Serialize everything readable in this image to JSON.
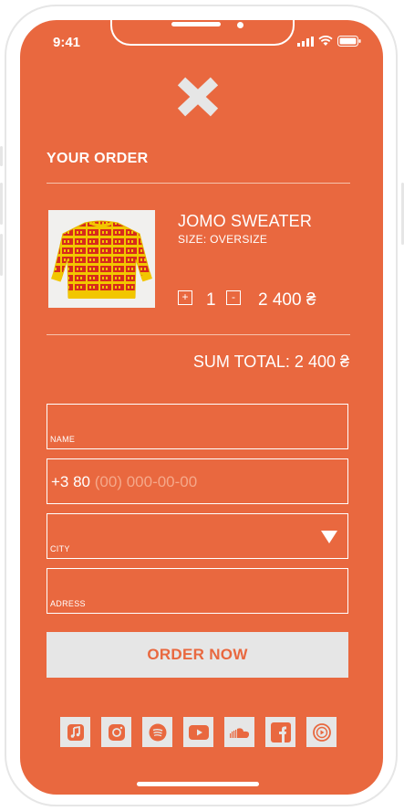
{
  "status_bar": {
    "time": "9:41"
  },
  "order": {
    "title": "YOUR ORDER",
    "item": {
      "name": "JOMO SWEATER",
      "size": "SIZE: OVERSIZE",
      "qty_plus": "+",
      "qty_minus": "-",
      "quantity": "1",
      "price": "2 400 ₴"
    },
    "sum_total": "SUM TOTAL: 2 400 ₴"
  },
  "form": {
    "name_label": "NAME",
    "phone_prefix": "+3 80",
    "phone_placeholder": "(00) 000-00-00",
    "city_label": "CITY",
    "address_label": "ADRESS"
  },
  "order_button": "ORDER NOW",
  "socials": [
    "apple-music-icon",
    "instagram-icon",
    "spotify-icon",
    "youtube-icon",
    "soundcloud-icon",
    "facebook-icon",
    "youtube-music-icon"
  ],
  "colors": {
    "accent": "#e9683f",
    "light": "#e6e6e6",
    "sweater_red": "#d72a1c",
    "sweater_yellow": "#f2c600"
  }
}
